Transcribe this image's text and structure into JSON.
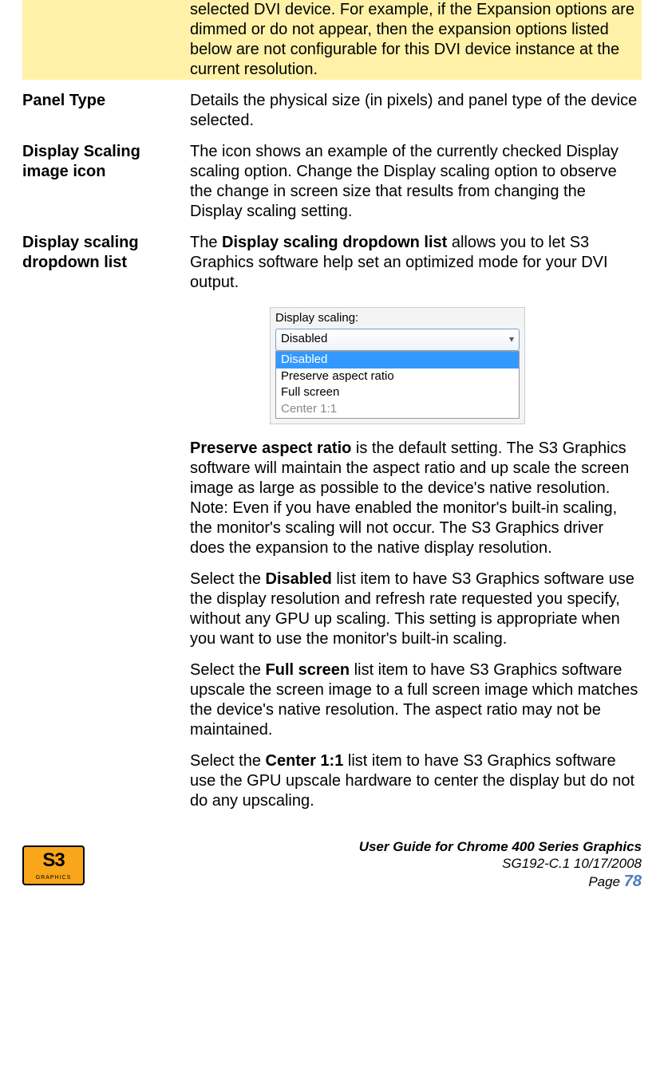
{
  "note_row": {
    "text": "selected DVI device. For example, if the Expansion options are dimmed or do not appear, then the expansion options listed below are not configurable for this DVI device instance at the current resolution."
  },
  "rows": {
    "panel_type": {
      "term": "Panel Type",
      "desc": "Details the physical size (in pixels) and panel type of the device selected."
    },
    "scaling_icon": {
      "term": "Display Scaling image icon",
      "desc": "The icon shows an example of the currently checked Display scaling option. Change the Display scaling option to observe the change in screen size that results from changing the Display scaling setting."
    },
    "scaling_list": {
      "term": "Display scaling dropdown list",
      "intro_pre": "The ",
      "intro_bold": "Display scaling dropdown list",
      "intro_post": " allows you to let S3 Graphics software help set an optimized mode for your DVI output.",
      "preserve_bold": "Preserve aspect ratio",
      "preserve_rest": " is the default setting. The S3 Graphics software will maintain the aspect ratio and up scale the screen image as large as possible to the device's native resolution.",
      "preserve_note": "Note: Even if you have enabled the monitor's built-in scaling, the monitor's scaling will not occur. The S3 Graphics driver does the expansion to the native display resolution.",
      "disabled_pre": "Select the ",
      "disabled_bold": "Disabled",
      "disabled_post": " list item to have S3 Graphics software use the display resolution and refresh rate requested you specify, without any GPU up scaling. This setting is appropriate when you want to use the monitor's built-in scaling.",
      "full_pre": "Select the ",
      "full_bold": "Full screen",
      "full_post": " list item to have S3 Graphics software upscale the screen image to a full screen image which matches the device's native resolution. The aspect ratio may not be maintained.",
      "center_pre": "Select the ",
      "center_bold": "Center 1:1",
      "center_post": " list item to have S3 Graphics software use the GPU upscale hardware to center the display but do not do any upscaling."
    }
  },
  "dropdown": {
    "label": "Display scaling:",
    "selected": "Disabled",
    "items": [
      "Disabled",
      "Preserve aspect ratio",
      "Full screen",
      "Center 1:1"
    ]
  },
  "footer": {
    "line1": "User Guide for Chrome 400 Series Graphics",
    "line2": "SG192-C.1   10/17/2008",
    "page_label": "Page ",
    "page_num": "78",
    "logo_text": "S3",
    "logo_sub": "GRAPHICS"
  }
}
